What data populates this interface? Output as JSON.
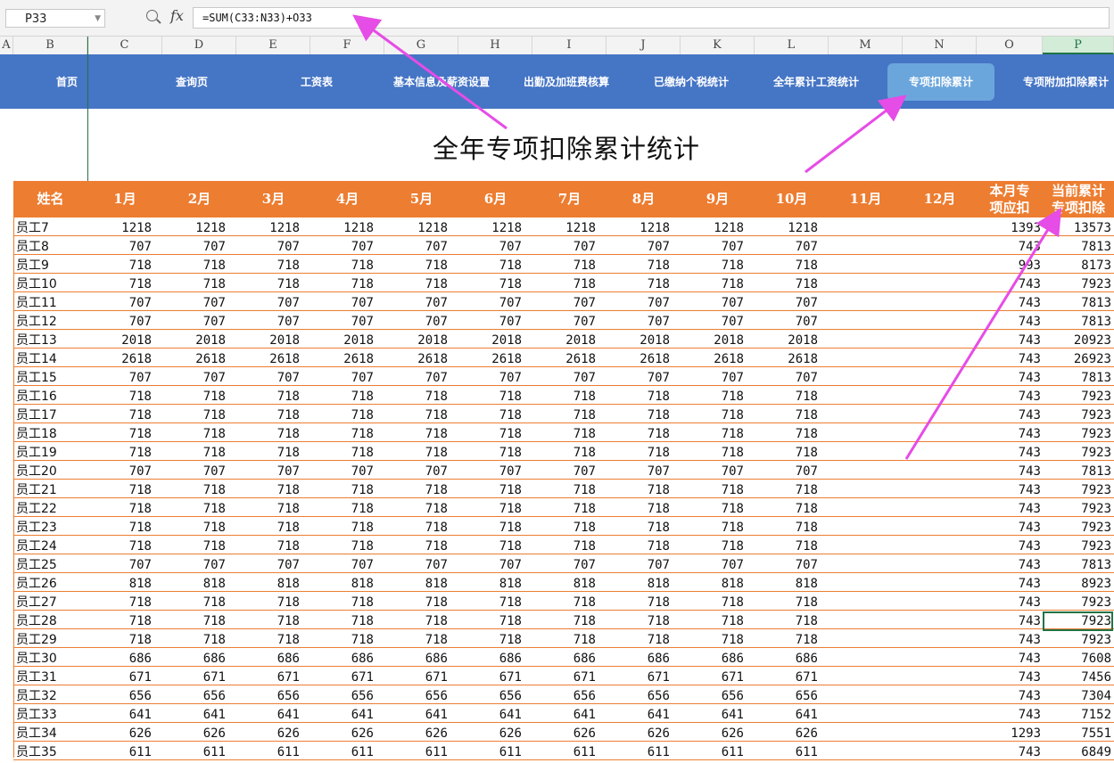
{
  "formula_bar": {
    "name_box": "P33",
    "formula": "=SUM(C33:N33)+O33"
  },
  "icons": {
    "zoom": "zoom-icon",
    "function": "fx-icon",
    "dropdown": "chevron-down-icon"
  },
  "column_headers": [
    "A",
    "B",
    "C",
    "D",
    "E",
    "F",
    "G",
    "H",
    "I",
    "J",
    "K",
    "L",
    "M",
    "N",
    "O",
    "P"
  ],
  "selected_column": "P",
  "nav": {
    "items": [
      "首页",
      "查询页",
      "工资表",
      "基本信息及薪资设置",
      "出勤及加班费核算",
      "已缴纳个税统计",
      "全年累计工资统计",
      "专项扣除累计",
      "专项附加扣除累计"
    ],
    "active": "专项扣除累计"
  },
  "sheet": {
    "title": "全年专项扣除累计统计",
    "headers": [
      "姓名",
      "1月",
      "2月",
      "3月",
      "4月",
      "5月",
      "6月",
      "7月",
      "8月",
      "9月",
      "10月",
      "11月",
      "12月",
      "本月专\n项应扣",
      "当前累计\n专项扣除"
    ],
    "rows": [
      {
        "name": "员工7",
        "monthly": "1218",
        "current": "1393",
        "total": "13573"
      },
      {
        "name": "员工8",
        "monthly": "707",
        "current": "743",
        "total": "7813"
      },
      {
        "name": "员工9",
        "monthly": "718",
        "current": "993",
        "total": "8173"
      },
      {
        "name": "员工10",
        "monthly": "718",
        "current": "743",
        "total": "7923"
      },
      {
        "name": "员工11",
        "monthly": "707",
        "current": "743",
        "total": "7813"
      },
      {
        "name": "员工12",
        "monthly": "707",
        "current": "743",
        "total": "7813"
      },
      {
        "name": "员工13",
        "monthly": "2018",
        "current": "743",
        "total": "20923"
      },
      {
        "name": "员工14",
        "monthly": "2618",
        "current": "743",
        "total": "26923"
      },
      {
        "name": "员工15",
        "monthly": "707",
        "current": "743",
        "total": "7813"
      },
      {
        "name": "员工16",
        "monthly": "718",
        "current": "743",
        "total": "7923"
      },
      {
        "name": "员工17",
        "monthly": "718",
        "current": "743",
        "total": "7923"
      },
      {
        "name": "员工18",
        "monthly": "718",
        "current": "743",
        "total": "7923"
      },
      {
        "name": "员工19",
        "monthly": "718",
        "current": "743",
        "total": "7923"
      },
      {
        "name": "员工20",
        "monthly": "707",
        "current": "743",
        "total": "7813"
      },
      {
        "name": "员工21",
        "monthly": "718",
        "current": "743",
        "total": "7923"
      },
      {
        "name": "员工22",
        "monthly": "718",
        "current": "743",
        "total": "7923"
      },
      {
        "name": "员工23",
        "monthly": "718",
        "current": "743",
        "total": "7923"
      },
      {
        "name": "员工24",
        "monthly": "718",
        "current": "743",
        "total": "7923"
      },
      {
        "name": "员工25",
        "monthly": "707",
        "current": "743",
        "total": "7813"
      },
      {
        "name": "员工26",
        "monthly": "818",
        "current": "743",
        "total": "8923"
      },
      {
        "name": "员工27",
        "monthly": "718",
        "current": "743",
        "total": "7923"
      },
      {
        "name": "员工28",
        "monthly": "718",
        "current": "743",
        "total": "7923"
      },
      {
        "name": "员工29",
        "monthly": "718",
        "current": "743",
        "total": "7923"
      },
      {
        "name": "员工30",
        "monthly": "686",
        "current": "743",
        "total": "7608"
      },
      {
        "name": "员工31",
        "monthly": "671",
        "current": "743",
        "total": "7456"
      },
      {
        "name": "员工32",
        "monthly": "656",
        "current": "743",
        "total": "7304"
      },
      {
        "name": "员工33",
        "monthly": "641",
        "current": "743",
        "total": "7152"
      },
      {
        "name": "员工34",
        "monthly": "626",
        "current": "1293",
        "total": "7551"
      },
      {
        "name": "员工35",
        "monthly": "611",
        "current": "743",
        "total": "6849"
      }
    ]
  },
  "colors": {
    "nav_bg": "#4575c5",
    "nav_active": "#6aa6dc",
    "header_bg": "#ed7d31",
    "selection": "#217346",
    "arrow": "#e64ce6"
  }
}
